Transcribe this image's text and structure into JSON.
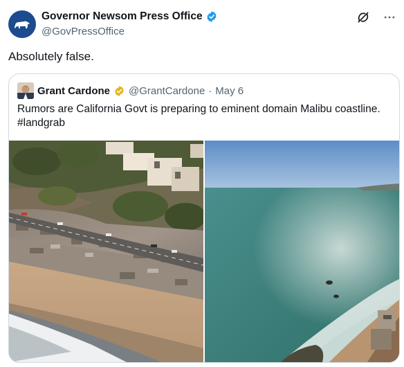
{
  "tweet": {
    "author": {
      "display_name": "Governor Newsom Press Office",
      "handle": "@GovPressOffice",
      "verified_color": "#1d9bf0",
      "avatar_icon": "california-bear-icon"
    },
    "text": "Absolutely false.",
    "actions": {
      "grok_icon": "grok-icon",
      "more_icon": "more-options-icon"
    }
  },
  "quoted_tweet": {
    "author": {
      "display_name": "Grant Cardone",
      "handle": "@GrantCardone",
      "separator": "·",
      "date": "May 6",
      "verified_color": "#e2b719"
    },
    "text": "Rumors are California Govt is preparing to eminent domain Malibu coastline. #landgrab",
    "media": [
      {
        "kind": "photo",
        "subject": "burned-coastal-neighborhood"
      },
      {
        "kind": "photo",
        "subject": "ocean-coastline"
      }
    ]
  },
  "colors": {
    "text_primary": "#0f1419",
    "text_secondary": "#536471",
    "border": "#cfd9de",
    "avatar_bg": "#1d4b8f"
  }
}
